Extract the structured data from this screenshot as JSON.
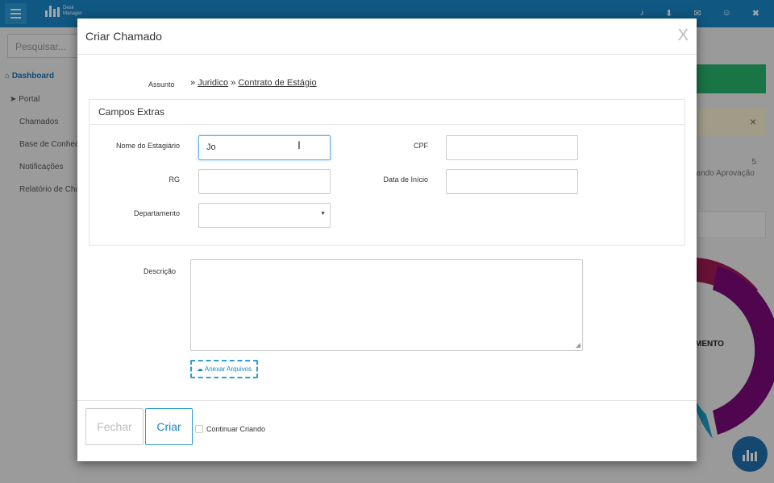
{
  "topbar": {
    "logo_line1": "Desk",
    "logo_line2": "Manager",
    "icons": [
      "bell-icon",
      "download-icon",
      "chat-icon",
      "user-icon",
      "close-icon"
    ],
    "icon_glyphs": [
      "♪",
      "⬇",
      "✉",
      "☺",
      "✖"
    ]
  },
  "sidebar": {
    "search_placeholder": "Pesquisar...",
    "items": [
      {
        "label": "Dashboard"
      },
      {
        "label": "Portal"
      },
      {
        "label": "Chamados"
      },
      {
        "label": "Base de Conhecim"
      },
      {
        "label": "Notificações"
      },
      {
        "label": "Relatório de Cham"
      }
    ]
  },
  "background": {
    "count": "5",
    "status_text": "dando Aprovação",
    "donut_label": "MENTO"
  },
  "modal": {
    "title": "Criar Chamado",
    "close_label": "X",
    "assunto_label": "Assunto",
    "breadcrumb_sep": "»",
    "breadcrumb": [
      "Juridico",
      "Contrato de Estágio"
    ],
    "campos_title": "Campos Extras",
    "fields": {
      "nome_label": "Nome do Estagiário",
      "nome_value": "Jo",
      "cpf_label": "CPF",
      "cpf_value": "",
      "rg_label": "RG",
      "rg_value": "",
      "data_label": "Data de Início",
      "data_value": "",
      "departamento_label": "Departamento",
      "departamento_value": ""
    },
    "descricao_label": "Descrição",
    "anexar_label": "Anexar Arquivos",
    "fechar_label": "Fechar",
    "criar_label": "Criar",
    "continuar_label": "Continuar Criando"
  }
}
